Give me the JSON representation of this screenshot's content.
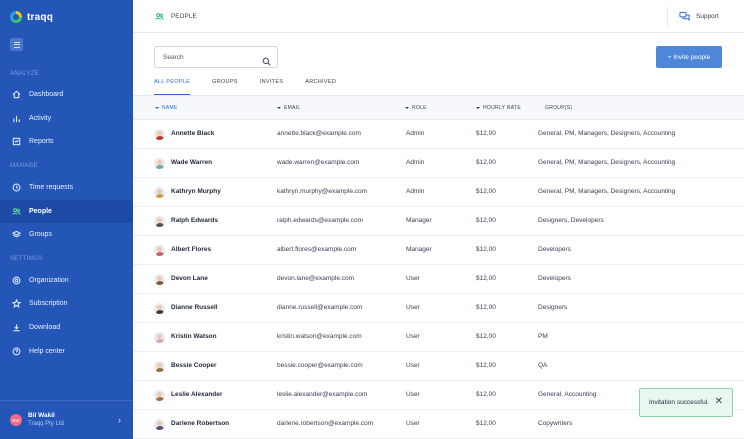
{
  "app": {
    "name": "traqq"
  },
  "sidebar": {
    "sections": {
      "analyze": "ANALYZE",
      "manage": "MANAGE",
      "settings": "SETTINGS"
    },
    "items": [
      {
        "label": "Dashboard",
        "icon": "home-icon"
      },
      {
        "label": "Activity",
        "icon": "activity-icon"
      },
      {
        "label": "Reports",
        "icon": "reports-icon"
      },
      {
        "label": "Time requests",
        "icon": "clock-icon"
      },
      {
        "label": "People",
        "icon": "people-icon",
        "active": true
      },
      {
        "label": "Groups",
        "icon": "layers-icon"
      },
      {
        "label": "Organization",
        "icon": "settings-icon"
      },
      {
        "label": "Subscription",
        "icon": "star-icon"
      },
      {
        "label": "Download",
        "icon": "download-icon"
      },
      {
        "label": "Help center",
        "icon": "help-icon"
      }
    ],
    "user": {
      "initials": "BW",
      "name": "Bil Wakil",
      "org": "Traqq Pty Ltd"
    }
  },
  "header": {
    "breadcrumb": "PEOPLE",
    "support": "Support"
  },
  "toolbar": {
    "search_placeholder": "Search",
    "invite_label": "+ Invite people"
  },
  "tabs": [
    {
      "label": "ALL PEOPLE",
      "active": true
    },
    {
      "label": "GROUPS"
    },
    {
      "label": "INVITES"
    },
    {
      "label": "ARCHIVED"
    }
  ],
  "table": {
    "columns": {
      "name": "NAME",
      "email": "EMAIL",
      "role": "ROLE",
      "rate": "HOURLY RATE",
      "groups": "GROUP(S)"
    },
    "rows": [
      {
        "name": "Annette Black",
        "email": "annette.black@example.com",
        "role": "Admin",
        "rate": "$12,00",
        "groups": "General, PM, Managers, Designers, Accounting"
      },
      {
        "name": "Wade Warren",
        "email": "wade.warren@example.com",
        "role": "Admin",
        "rate": "$12,00",
        "groups": "General, PM, Managers, Designers, Accounting"
      },
      {
        "name": "Kathryn Murphy",
        "email": "kathryn.murphy@example.com",
        "role": "Admin",
        "rate": "$12,00",
        "groups": "General, PM, Managers, Designers, Accounting"
      },
      {
        "name": "Ralph Edwards",
        "email": "ralph.edwards@example.com",
        "role": "Manager",
        "rate": "$12,00",
        "groups": "Designers, Developers"
      },
      {
        "name": "Albert Flores",
        "email": "albert.flores@example.com",
        "role": "Manager",
        "rate": "$12,00",
        "groups": "Developers"
      },
      {
        "name": "Devon Lane",
        "email": "devon.lane@example.com",
        "role": "User",
        "rate": "$12,00",
        "groups": "Developers"
      },
      {
        "name": "Dianne Russell",
        "email": "dianne.russell@example.com",
        "role": "User",
        "rate": "$12,00",
        "groups": "Designers"
      },
      {
        "name": "Kristin Watson",
        "email": "kristin.watson@example.com",
        "role": "User",
        "rate": "$12,00",
        "groups": "PM"
      },
      {
        "name": "Bessie Cooper",
        "email": "bessie.cooper@example.com",
        "role": "User",
        "rate": "$12,00",
        "groups": "QA"
      },
      {
        "name": "Leslie Alexander",
        "email": "leslie.alexander@example.com",
        "role": "User",
        "rate": "$12,00",
        "groups": "General, Accounting"
      },
      {
        "name": "Darlene Robertson",
        "email": "darlene.robertson@example.com",
        "role": "User",
        "rate": "$12,00",
        "groups": "Copywriters"
      }
    ]
  },
  "toast": {
    "message": "Invitation successful."
  },
  "colors": {
    "sidebar": "#2456b8",
    "accent": "#2b6cd9",
    "primary_button": "#4e86d9",
    "success": "#3bbf86"
  }
}
